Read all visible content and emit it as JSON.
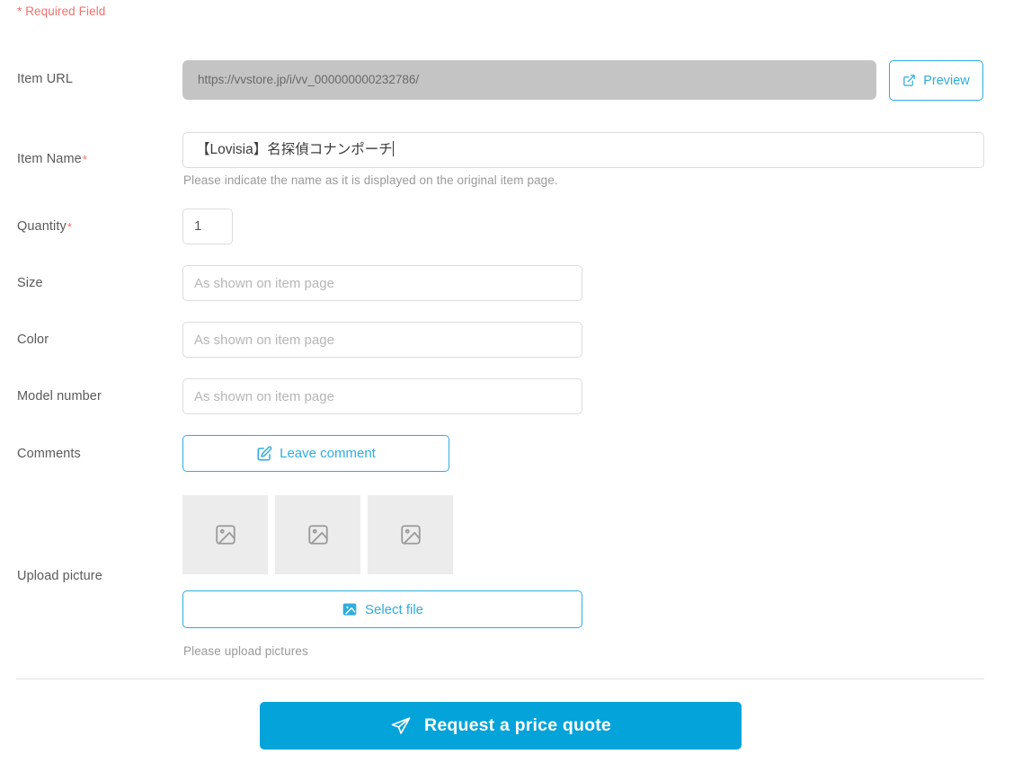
{
  "form": {
    "required_note": "* Required Field",
    "required_marker": "*",
    "fields": {
      "item_url": {
        "label": "Item URL",
        "value": "https://vvstore.jp/i/vv_000000000232786/",
        "preview_button": "Preview",
        "preview_icon": "external-link-icon"
      },
      "item_name": {
        "label": "Item Name",
        "value": "【Lovisia】名探偵コナンポーチ",
        "hint": "Please indicate the name as it is displayed on the original item page."
      },
      "quantity": {
        "label": "Quantity",
        "value": "1"
      },
      "size": {
        "label": "Size",
        "placeholder": "As shown on item page",
        "value": ""
      },
      "color": {
        "label": "Color",
        "placeholder": "As shown on item page",
        "value": ""
      },
      "model_number": {
        "label": "Model number",
        "placeholder": "As shown on item page",
        "value": ""
      },
      "comments": {
        "label": "Comments",
        "button_label": "Leave comment",
        "button_icon": "edit-square-icon"
      },
      "upload_picture": {
        "label": "Upload picture",
        "button_label": "Select file",
        "button_icon": "image-icon",
        "hint": "Please upload pictures",
        "thumbnails": [
          {
            "icon": "image-placeholder-icon"
          },
          {
            "icon": "image-placeholder-icon"
          },
          {
            "icon": "image-placeholder-icon"
          }
        ]
      }
    },
    "submit": {
      "label": "Request a price quote",
      "icon": "send-icon"
    }
  },
  "colors": {
    "accent": "#04a3da",
    "outline_accent": "#2eadde",
    "required": "#f0726e",
    "readonly_bg": "#c4c4c4",
    "thumb_bg": "#ececec"
  }
}
